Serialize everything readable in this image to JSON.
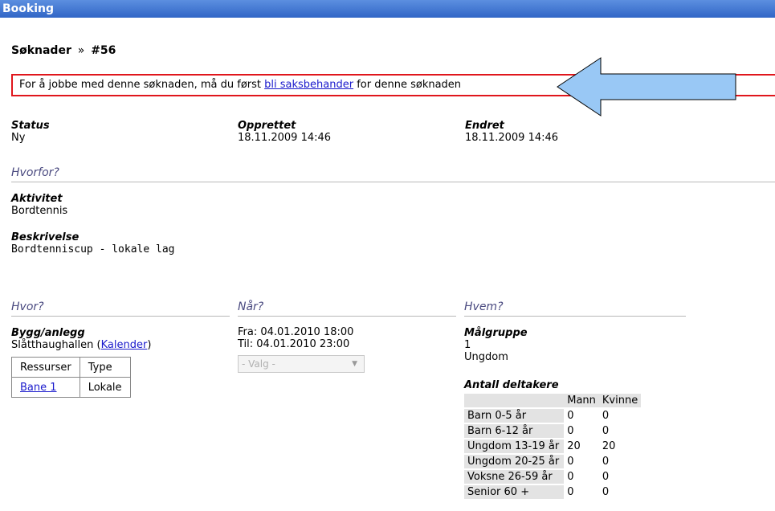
{
  "window": {
    "title": "Booking"
  },
  "breadcrumb": {
    "section": "Søknader",
    "separator": "»",
    "id": "#56"
  },
  "notice": {
    "prefix": "For å jobbe med denne søknaden, må du først ",
    "link": "bli saksbehander",
    "suffix": " for denne søknaden"
  },
  "meta": {
    "status_label": "Status",
    "status_value": "Ny",
    "created_label": "Opprettet",
    "created_value": "18.11.2009 14:46",
    "changed_label": "Endret",
    "changed_value": "18.11.2009 14:46"
  },
  "why": {
    "title": "Hvorfor?",
    "activity_label": "Aktivitet",
    "activity_value": "Bordtennis",
    "description_label": "Beskrivelse",
    "description_value": "Bordtenniscup - lokale lag"
  },
  "where": {
    "title": "Hvor?",
    "building_label": "Bygg/anlegg",
    "building_value": "Slåtthaughallen",
    "calendar_link": "Kalender",
    "table_headers": [
      "Ressurser",
      "Type"
    ],
    "resources": [
      {
        "name": "Bane 1",
        "type": "Lokale"
      }
    ]
  },
  "when": {
    "title": "Når?",
    "from": "Fra: 04.01.2010 18:00",
    "to": "Til: 04.01.2010 23:00",
    "select_placeholder": "- Valg -"
  },
  "who": {
    "title": "Hvem?",
    "target_label": "Målgruppe",
    "target_values": [
      "1",
      "Ungdom"
    ],
    "participants_label": "Antall deltakere",
    "col_headers": [
      "Mann",
      "Kvinne"
    ],
    "rows": [
      {
        "label": "Barn 0-5 år",
        "men": "0",
        "women": "0"
      },
      {
        "label": "Barn 6-12 år",
        "men": "0",
        "women": "0"
      },
      {
        "label": "Ungdom 13-19 år",
        "men": "20",
        "women": "20"
      },
      {
        "label": "Ungdom 20-25 år",
        "men": "0",
        "women": "0"
      },
      {
        "label": "Voksne 26-59 år",
        "men": "0",
        "women": "0"
      },
      {
        "label": "Senior 60 +",
        "men": "0",
        "women": "0"
      }
    ]
  },
  "icons": {
    "annotation": "arrow-left-icon",
    "dropdown": "chevron-down-icon"
  },
  "colors": {
    "accent": "#3166c6",
    "notice_border": "#e0161c",
    "arrow_fill": "#99c8f5",
    "link": "#1a1acc"
  }
}
